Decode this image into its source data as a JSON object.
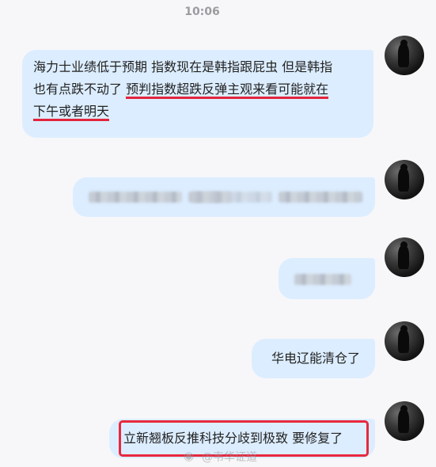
{
  "chat": {
    "timestamp": "10:06",
    "messages": [
      {
        "line1": "海力士业绩低于预期 指数现在是韩指跟屁虫 但是韩指",
        "line2_plain": "也有点跌不动了 ",
        "line2_underlined": "预判指数超跌反弹主观来看可能就在",
        "line3_underlined": "下午或者明天"
      },
      {
        "text": ""
      },
      {
        "text": ""
      },
      {
        "text": "华电辽能清仓了"
      },
      {
        "text": "立新翘板反推科技分歧到极致 要修复了"
      }
    ]
  },
  "watermark": {
    "icon": "weibo-icon",
    "text": "@韦华证道"
  },
  "colors": {
    "bubble": "#dcedff",
    "highlight": "#e8283e",
    "background": "#f7f7f9"
  }
}
